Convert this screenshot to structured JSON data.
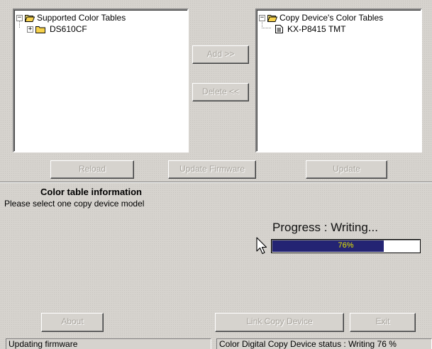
{
  "supported_tree": {
    "root_label": "Supported Color Tables",
    "children": [
      "DS610CF"
    ]
  },
  "device_tree": {
    "root_label": "Copy Device's Color Tables",
    "children": [
      "KX-P8415 TMT"
    ]
  },
  "buttons": {
    "add": "Add >>",
    "delete": "Delete <<",
    "reload": "Reload",
    "update_firmware": "Update Firmware",
    "update": "Update",
    "about": "About",
    "link_copy_device": "Link Copy Device",
    "exit": "Exit"
  },
  "info": {
    "title": "Color table information",
    "message": "Please select one copy device model"
  },
  "progress": {
    "label": "Progress : Writing...",
    "percent_text": "76%",
    "value": 0.76,
    "fill_color": "#242473",
    "text_color": "#e8e800"
  },
  "status": {
    "left": "Updating firmware",
    "right": "Color Digital Copy Device status : Writing 76 %"
  },
  "icons": {
    "tree_expanded": "minus-box-icon",
    "tree_collapsed": "plus-box-icon",
    "open_folder": "open-folder-icon",
    "closed_folder": "folder-icon",
    "document": "document-icon",
    "cursor": "mouse-pointer-icon"
  }
}
